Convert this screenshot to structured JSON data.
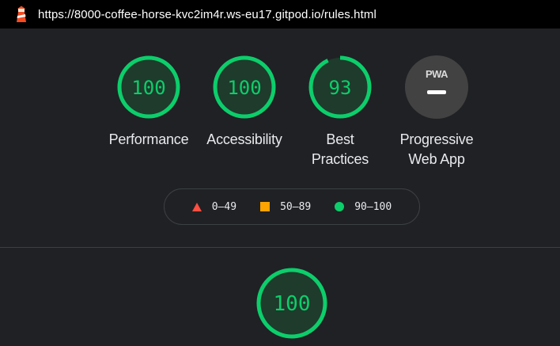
{
  "browser": {
    "url": "https://8000-coffee-horse-kvc2im4r.ws-eu17.gitpod.io/rules.html",
    "logo_icon": "lighthouse-icon"
  },
  "scores": [
    {
      "label": "Performance",
      "score": "100",
      "value": 100
    },
    {
      "label": "Accessibility",
      "score": "100",
      "value": 100
    },
    {
      "label": "Best Practices",
      "score": "93",
      "value": 93
    }
  ],
  "pwa": {
    "badge_text": "PWA",
    "label": "Progressive Web App"
  },
  "legend": {
    "items": [
      {
        "range": "0–49",
        "icon": "triangle-icon",
        "color": "#ff4e42"
      },
      {
        "range": "50–89",
        "icon": "square-icon",
        "color": "#ffa400"
      },
      {
        "range": "90–100",
        "icon": "circle-icon",
        "color": "#0cce6b"
      }
    ]
  },
  "section_score": {
    "score": "100",
    "value": 100
  },
  "colors": {
    "pass": "#0cce6b",
    "pass_fill": "#1e3b2b",
    "average": "#ffa400",
    "fail": "#ff4e42"
  }
}
